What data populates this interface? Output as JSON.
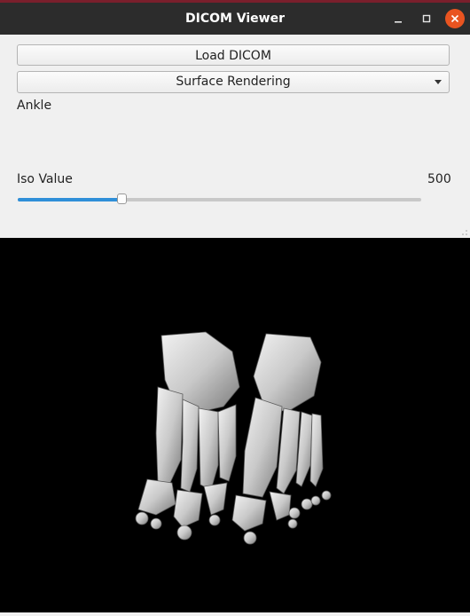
{
  "window": {
    "title": "DICOM Viewer"
  },
  "controls": {
    "load_button": "Load DICOM",
    "render_mode": "Surface Rendering",
    "dataset_label": "Ankle",
    "iso_label": "Iso Value",
    "iso_value": "500",
    "iso_slider_fraction": 0.26
  },
  "viewport": {
    "content": "3D surface rendering of foot bones"
  },
  "icons": {
    "minimize": "minimize-icon",
    "maximize": "maximize-icon",
    "close": "close-icon",
    "dropdown": "chevron-down-icon"
  },
  "colors": {
    "accent": "#2f8fd8",
    "titlebar": "#2c2c2c",
    "close": "#e95420",
    "viewport_bg": "#000000"
  }
}
